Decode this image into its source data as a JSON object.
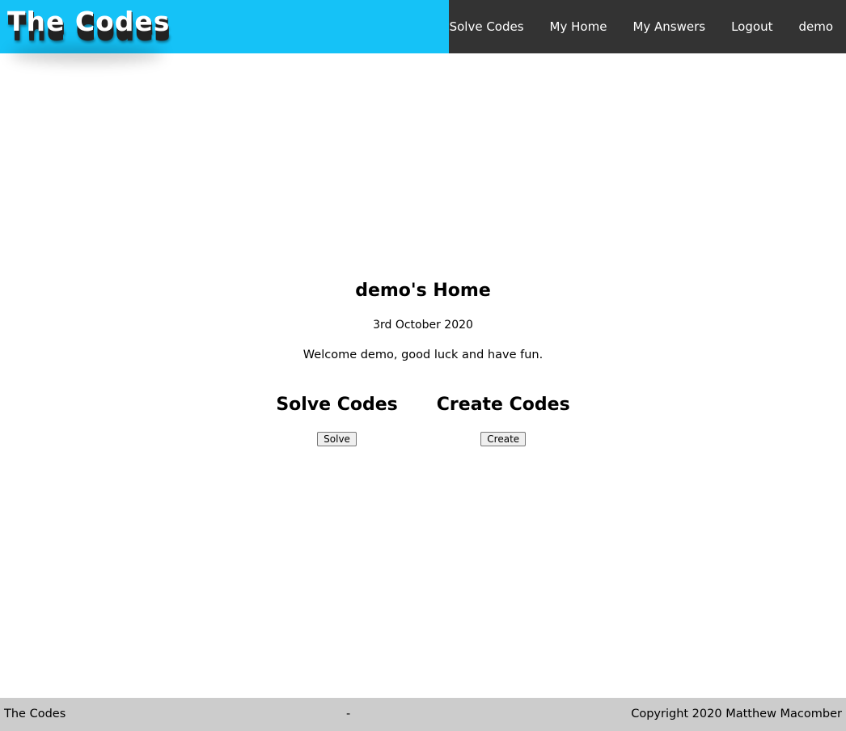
{
  "header": {
    "logo": "The Codes",
    "brand_color": "#15c2f7",
    "nav_color": "#333333",
    "nav": [
      {
        "label": "Solve Codes"
      },
      {
        "label": "My Home"
      },
      {
        "label": "My Answers"
      },
      {
        "label": "Logout"
      },
      {
        "label": "demo"
      }
    ]
  },
  "main": {
    "title": "demo's Home",
    "date": "3rd October 2020",
    "welcome": "Welcome demo, good luck and have fun.",
    "sections": [
      {
        "heading": "Solve Codes",
        "button": "Solve"
      },
      {
        "heading": "Create Codes",
        "button": "Create"
      }
    ]
  },
  "footer": {
    "left": "The Codes",
    "middle": "-",
    "right": "Copyright 2020 Matthew Macomber",
    "background": "#cccccc"
  }
}
